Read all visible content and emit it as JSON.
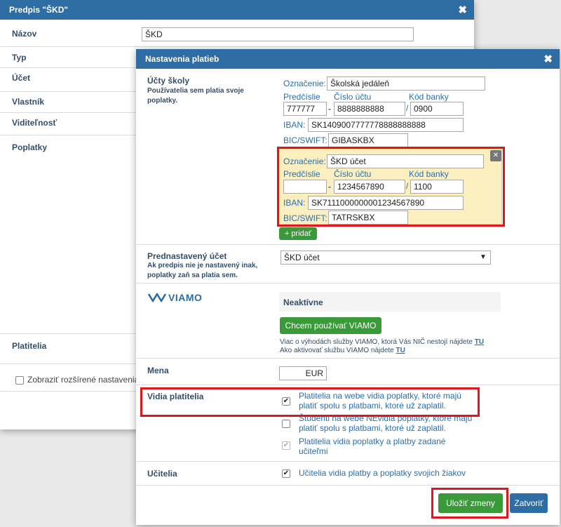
{
  "back_dialog": {
    "title": "Predpis \"ŠKD\"",
    "close_glyph": "✖",
    "rows": {
      "nazov": "Názov",
      "typ": "Typ",
      "ucet": "Účet",
      "vlastnik": "Vlastník",
      "viditelnost": "Viditeľnosť",
      "poplatky": "Poplatky",
      "platitelia": "Platitelia"
    },
    "nazov_value": "ŠKD",
    "extended_checkbox_label": "Zobraziť rozšírené nastavenia"
  },
  "front_dialog": {
    "title": "Nastavenia platieb",
    "close_glyph": "✖",
    "accounts_section": {
      "label": "Účty školy",
      "description": "Používatelia sem platia svoje poplatky.",
      "field_labels": {
        "oznacenie": "Označenie:",
        "predcislie": "Predčíslie",
        "cislo_uctu": "Číslo účtu",
        "kod_banky": "Kód banky",
        "iban": "IBAN:",
        "bic": "BIC/SWIFT:",
        "dash": "-",
        "slash": "/"
      },
      "accounts": [
        {
          "oznacenie": "Školská jedáleň",
          "predcislie": "777777",
          "cislo_uctu": "8888888888",
          "kod_banky": "0900",
          "iban": "SK1409007777778888888888",
          "bic": "GIBASKBX"
        },
        {
          "oznacenie": "ŠKD účet",
          "predcislie": "",
          "cislo_uctu": "1234567890",
          "kod_banky": "1100",
          "iban": "SK7111000000001234567890",
          "bic": "TATRSKBX"
        }
      ],
      "remove_glyph": "✕",
      "add_button": "+ pridať"
    },
    "preset_section": {
      "label": "Prednastavený účet",
      "description": "Ak predpis nie je nastavený inak, poplatky zaň sa platia sem.",
      "selected": "ŠKD účet",
      "arrow": "▼"
    },
    "viamo_section": {
      "logo_text": "VIAMO",
      "status": "Neaktívne",
      "button": "Chcem používať VIAMO",
      "info_line1": "Viac o výhodách služby VIAMO, ktorá Vás NIČ nestojí nájdete",
      "info_line2": "Ako aktivovať službu VIAMO nájdete",
      "link": "TU"
    },
    "currency_section": {
      "label": "Mena",
      "value": "EUR"
    },
    "payer_section": {
      "label": "Vidia platitelia",
      "options": [
        {
          "text": "Platitelia na webe vidia poplatky, ktoré majú platiť spolu s platbami, ktoré už zaplatil.",
          "checked": true,
          "disabled": false
        },
        {
          "text": "Študenti na webe NEvidia poplatky, ktoré majú platiť spolu s platbami, ktoré už zaplatil.",
          "checked": false,
          "disabled": false
        },
        {
          "text": "Platitelia vidia poplatky a platby zadané učiteľmi",
          "checked": true,
          "disabled": true
        }
      ]
    },
    "teachers_section": {
      "label": "Učitelia",
      "option": "Učitelia vidia platby a poplatky svojich žiakov",
      "checked": true
    },
    "footer": {
      "save": "Uložiť zmeny",
      "close": "Zatvoriť"
    },
    "check_glyph": "✔"
  },
  "colors": {
    "header": "#2d6da3",
    "highlight": "#fcefbf",
    "highlight_border": "#e0161e",
    "button_green": "#3a9a3a",
    "button_blue": "#2d6da3"
  }
}
